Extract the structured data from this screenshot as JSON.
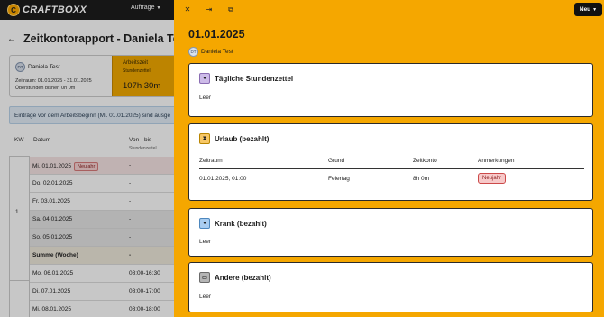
{
  "topnav": {
    "brand": "CRAFTBOXX",
    "brand_mark": "C",
    "menu_label": "Aufträge"
  },
  "page": {
    "title": "Zeitkontorapport - Daniela Tes"
  },
  "summary": {
    "person_initials": "DT",
    "person_name": "Daniela Test",
    "period_line": "Zeitraum: 01.01.2025 - 31.01.2025",
    "overtime_line": "Überstunden bisher: 0h 0m",
    "work_label": "Arbeitszeit",
    "work_sub": "Stundenzettel",
    "work_value": "107h 30m"
  },
  "info_text": "Einträge vor dem Arbeitsbeginn (Mi. 01.01.2025) sind ausge",
  "table": {
    "headers": {
      "kw": "KW",
      "datum": "Datum",
      "von_bis": "Von - bis",
      "von_bis_sub": "Stundenzettel"
    },
    "kw1": "1",
    "rows": [
      {
        "date": "Mi. 01.01.2025",
        "value": "-",
        "badge": "Neujahr"
      },
      {
        "date": "Do. 02.01.2025",
        "value": "-"
      },
      {
        "date": "Fr. 03.01.2025",
        "value": "-"
      },
      {
        "date": "Sa. 04.01.2025",
        "value": "-"
      },
      {
        "date": "So. 05.01.2025",
        "value": "-"
      },
      {
        "date": "Summe (Woche)",
        "value": "-"
      },
      {
        "date": "Mo. 06.01.2025",
        "value": "08:00-16:30"
      },
      {
        "date": "Di. 07.01.2025",
        "value": "08:00-17:00"
      },
      {
        "date": "Mi. 08.01.2025",
        "value": "08:00-18:00"
      }
    ]
  },
  "drawer": {
    "new_button": "Neu",
    "date": "01.01.2025",
    "person_initials": "DT",
    "person_name": "Daniela Test",
    "cards": {
      "daily": {
        "title": "Tägliche Stundenzettel",
        "empty": "Leer"
      },
      "vacation": {
        "title": "Urlaub (bezahlt)",
        "columns": [
          "Zeitraum",
          "Grund",
          "Zeitkonto",
          "Anmerkungen"
        ],
        "row": {
          "zeitraum": "01.01.2025, 01:00",
          "grund": "Feiertag",
          "zeitkonto": "8h 0m",
          "anmerkung": "Neujahr"
        }
      },
      "sick": {
        "title": "Krank (bezahlt)",
        "empty": "Leer"
      },
      "other": {
        "title": "Andere (bezahlt)",
        "empty": "Leer"
      }
    }
  },
  "colors": {
    "accent": "#f5a700",
    "nav": "#1b1b1b",
    "holiday_badge": "#f7c9c9"
  },
  "icons": [
    "close-icon",
    "expand-icon",
    "open-external-icon",
    "chevron-down-icon",
    "back-arrow-icon",
    "daily-sheet-icon",
    "hourglass-icon",
    "sick-icon",
    "other-icon"
  ]
}
